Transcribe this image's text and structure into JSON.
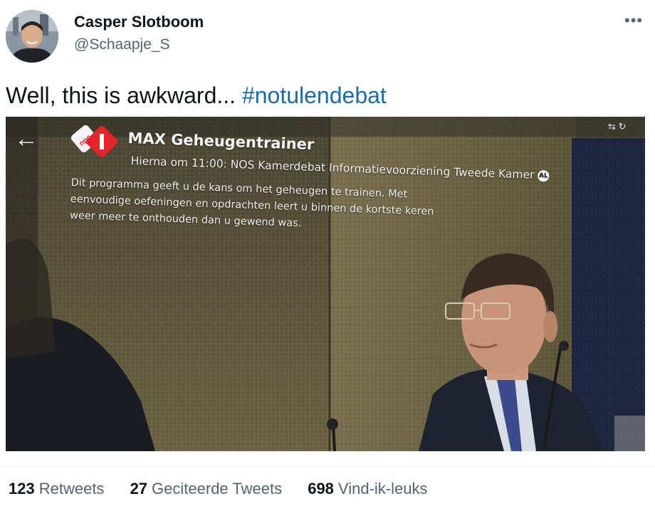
{
  "author": {
    "display_name": "Casper Slotboom",
    "handle": "@Schaapje_S"
  },
  "more_icon": "more-horizontal-icon",
  "tweet": {
    "text": "Well, this is awkward... ",
    "hashtag": "#notulendebat"
  },
  "media": {
    "tv_title": "MAX Geheugentrainer",
    "tv_subtitle": "Hierna om 11:00: NOS Kamerdebat Informatievoorziening Tweede Kamer",
    "tv_rating_badge": "AL",
    "tv_description_lines": [
      "Dit programma geeft u de kans om het geheugen te trainen. Met",
      "eenvoudige oefeningen en opdrachten leert u binnen de kortste keren",
      "weer meer te onthouden dan u gewend was."
    ],
    "tv_logo_text": "npo",
    "tv_channel_number": "1",
    "back_icon": "arrow-left-icon"
  },
  "stats": {
    "retweets_count": "123",
    "retweets_label": "Retweets",
    "quotes_count": "27",
    "quotes_label": "Geciteerde Tweets",
    "likes_count": "698",
    "likes_label": "Vind-ik-leuks"
  },
  "colors": {
    "hashtag": "#1b6ca8",
    "secondary_text": "#536471",
    "primary_text": "#0f1419",
    "npo_red": "#e3242b"
  }
}
